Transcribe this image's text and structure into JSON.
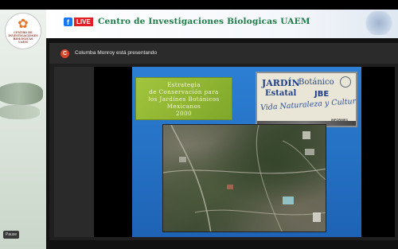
{
  "header": {
    "live_icon": "facebook-icon",
    "live_label": "LIVE",
    "title": "Centro de Investigaciones Biologicas UAEM"
  },
  "logo": {
    "mark": "flower-icon",
    "text_lines": [
      "CENTRO DE",
      "INVESTIGACIONES",
      "BIOLÓGICAS",
      "UAEM"
    ]
  },
  "controls": {
    "pause_label": "Pause"
  },
  "presenter": {
    "avatar_letter": "C",
    "text": "Columba Monroy está presentando"
  },
  "slide": {
    "title_lines": [
      "Estrategia",
      "de Conservación para",
      "los Jardines Botánicos",
      "Mexicanos",
      "2000"
    ],
    "sign": {
      "jardin": "JARDÍN",
      "botanico": "Botánico",
      "estatal": "Estatal",
      "jbe": "JBE",
      "motto": "Vida Naturaleza y Cultura",
      "informes": "INFORMES"
    }
  },
  "colors": {
    "live_red": "#e41e26",
    "facebook_blue": "#1877f2",
    "header_green": "#1c7d46",
    "slide_blue": "#2c7fd4",
    "title_box_green": "#a2c53c"
  }
}
